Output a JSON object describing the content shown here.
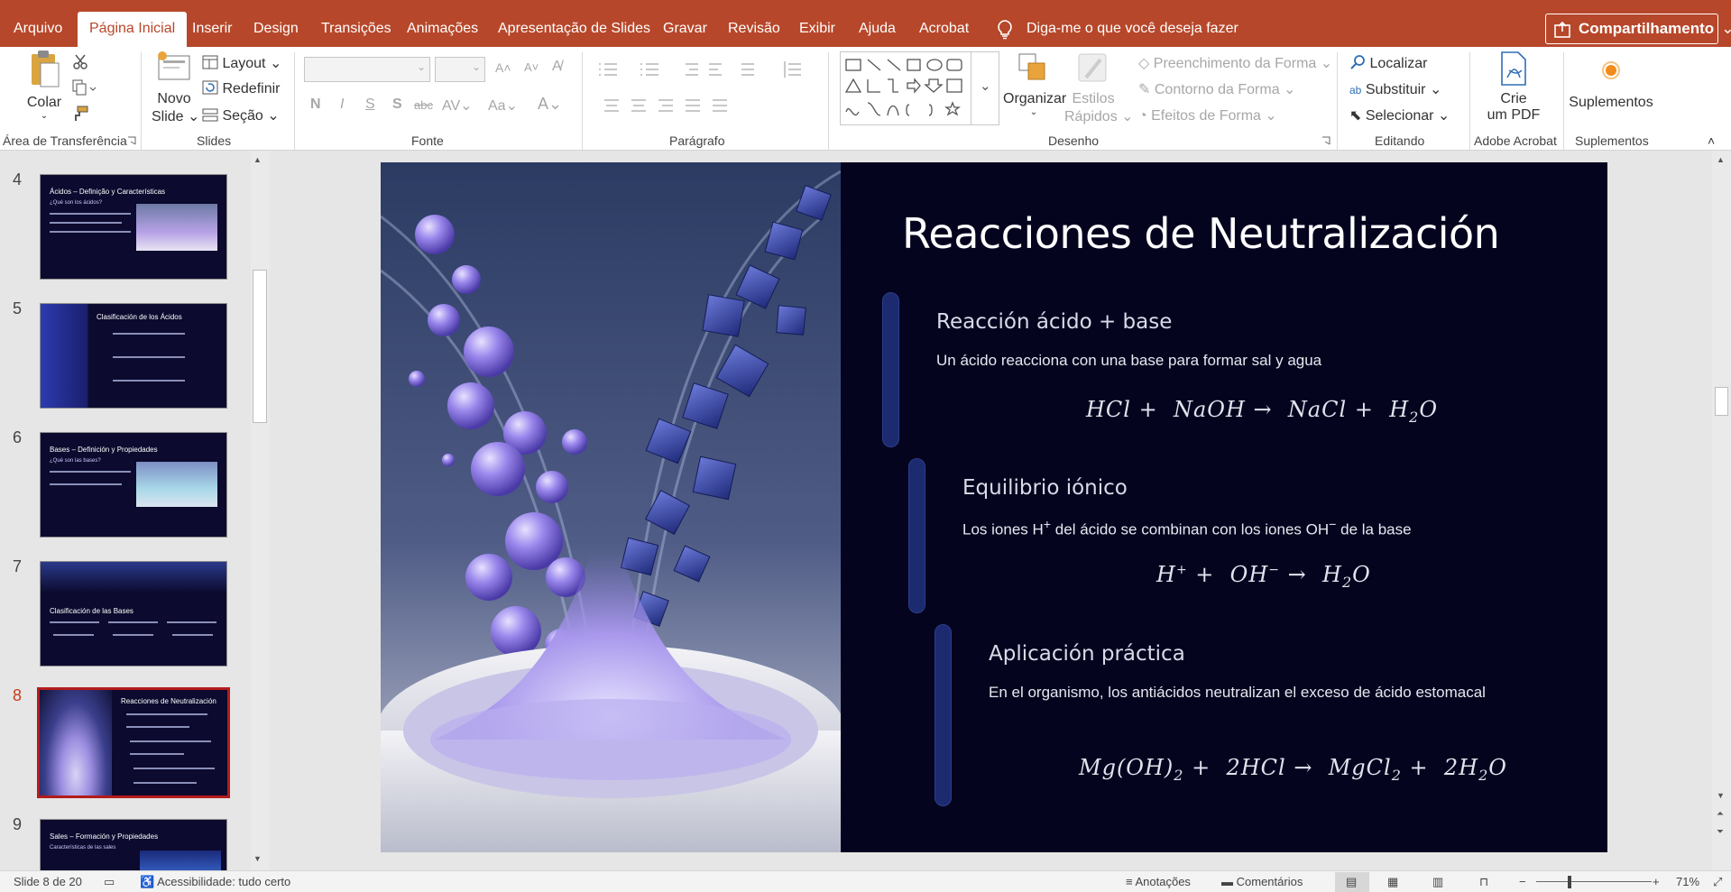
{
  "ribbon_tabs": [
    "Arquivo",
    "Página Inicial",
    "Inserir",
    "Design",
    "Transições",
    "Animações",
    "Apresentação de Slides",
    "Gravar",
    "Revisão",
    "Exibir",
    "Ajuda",
    "Acrobat"
  ],
  "active_tab": "Página Inicial",
  "tell_me": "Diga-me o que você deseja fazer",
  "share": "Compartilhamento",
  "clipboard": {
    "paste": "Colar",
    "group": "Área de Transferência"
  },
  "slides_group": {
    "new_slide_1": "Novo",
    "new_slide_2": "Slide",
    "layout": "Layout",
    "reset": "Redefinir",
    "section": "Seção",
    "group": "Slides"
  },
  "font_group": {
    "group": "Fonte"
  },
  "paragraph_group": {
    "group": "Parágrafo"
  },
  "drawing": {
    "arrange": "Organizar",
    "quick_styles_1": "Estilos",
    "quick_styles_2": "Rápidos",
    "shape_fill": "Preenchimento da Forma",
    "shape_outline": "Contorno da Forma",
    "shape_effects": "Efeitos de Forma",
    "group": "Desenho"
  },
  "editing": {
    "find": "Localizar",
    "replace": "Substituir",
    "select": "Selecionar",
    "group": "Editando"
  },
  "acrobat": {
    "create_1": "Crie",
    "create_2": "um PDF",
    "group": "Adobe Acrobat"
  },
  "addins": {
    "label": "Suplementos",
    "group": "Suplementos"
  },
  "thumbnails": [
    {
      "num": "4",
      "title": "Ácidos – Definição y Características",
      "sub": "¿Qué son los ácidos?"
    },
    {
      "num": "5",
      "title": "Clasificación de los Ácidos",
      "sub": ""
    },
    {
      "num": "6",
      "title": "Bases – Definición y Propiedades",
      "sub": "¿Qué son las bases?"
    },
    {
      "num": "7",
      "title": "Clasificación de las Bases",
      "sub": ""
    },
    {
      "num": "8",
      "title": "Reacciones de Neutralización",
      "sub": ""
    },
    {
      "num": "9",
      "title": "Sales – Formación y Propiedades",
      "sub": "Características de las sales"
    }
  ],
  "slide": {
    "title": "Reacciones de Neutralización",
    "sections": [
      {
        "heading": "Reacción ácido + base",
        "body": "Un ácido reacciona con una base para formar sal y agua",
        "formula": "HCl +  NaOH →  NaCl +  H₂O"
      },
      {
        "heading": "Equilibrio iónico",
        "body": "Los iones H⁺ del ácido se combinan con los iones OH⁻ de la base",
        "formula": "H⁺ +  OH⁻ →  H₂O"
      },
      {
        "heading": "Aplicación práctica",
        "body": "En el organismo, los antiácidos neutralizan el exceso de ácido estomacal",
        "formula": "Mg(OH)₂ +  2HCl →  MgCl₂ +  2H₂O"
      }
    ]
  },
  "status": {
    "slide_count": "Slide 8 de 20",
    "accessibility": "Acessibilidade: tudo certo",
    "notes": "Anotações",
    "comments": "Comentários",
    "zoom": "71%"
  },
  "colors": {
    "accent": "#b7472a",
    "slide_bg": "#05041f",
    "section_bar": "#1c2a6f"
  },
  "icons": [
    "lightbulb-icon",
    "share-icon",
    "paste-icon",
    "cut-icon",
    "copy-icon",
    "format-painter-icon",
    "new-slide-icon",
    "layout-icon",
    "reset-icon",
    "section-icon",
    "search-icon",
    "replace-icon",
    "select-icon",
    "pdf-icon",
    "addin-icon",
    "notes-icon",
    "comments-icon",
    "accessibility-icon"
  ]
}
